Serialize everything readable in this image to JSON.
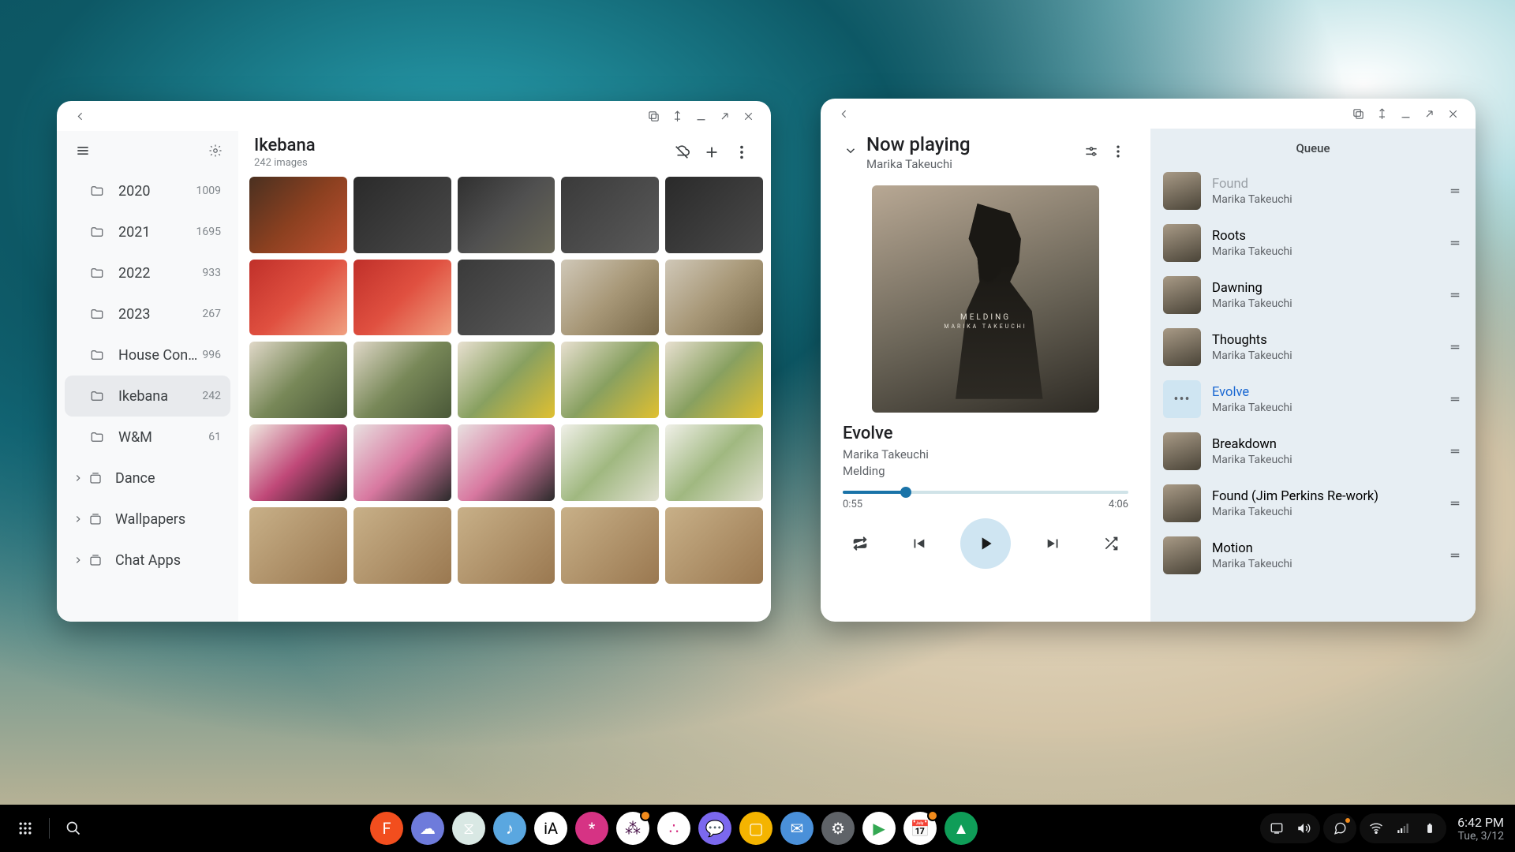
{
  "files": {
    "title": "Ikebana",
    "subtitle": "242 images",
    "folders": [
      {
        "name": "2020",
        "count": "1009"
      },
      {
        "name": "2021",
        "count": "1695"
      },
      {
        "name": "2022",
        "count": "933"
      },
      {
        "name": "2023",
        "count": "267"
      },
      {
        "name": "House Con...",
        "count": "996"
      },
      {
        "name": "Ikebana",
        "count": "242",
        "active": true
      },
      {
        "name": "W&M",
        "count": "61"
      }
    ],
    "collections": [
      {
        "name": "Dance"
      },
      {
        "name": "Wallpapers"
      },
      {
        "name": "Chat Apps"
      }
    ],
    "thumbs": [
      "th-a",
      "th-b",
      "th-c",
      "th-d",
      "th-b",
      "th-e",
      "th-e",
      "th-d",
      "th-f",
      "th-f",
      "th-g",
      "th-g",
      "th-h",
      "th-h",
      "th-h",
      "th-i",
      "th-j",
      "th-j",
      "th-k",
      "th-k",
      "th-l",
      "th-l",
      "th-l",
      "th-l",
      "th-l"
    ]
  },
  "music": {
    "now_playing_label": "Now playing",
    "np_artist": "Marika Takeuchi",
    "album_text_top": "MELDING",
    "album_text_sub": "MARIKA TAKEUCHI",
    "track": "Evolve",
    "track_artist": "Marika Takeuchi",
    "track_album": "Melding",
    "elapsed": "0:55",
    "duration": "4:06",
    "progress_pct": 22,
    "queue_label": "Queue",
    "queue": [
      {
        "title": "Found",
        "artist": "Marika Takeuchi",
        "partial": true
      },
      {
        "title": "Roots",
        "artist": "Marika Takeuchi"
      },
      {
        "title": "Dawning",
        "artist": "Marika Takeuchi"
      },
      {
        "title": "Thoughts",
        "artist": "Marika Takeuchi"
      },
      {
        "title": "Evolve",
        "artist": "Marika Takeuchi",
        "current": true
      },
      {
        "title": "Breakdown",
        "artist": "Marika Takeuchi"
      },
      {
        "title": "Found (Jim Perkins Re-work)",
        "artist": "Marika Takeuchi"
      },
      {
        "title": "Motion",
        "artist": "Marika Takeuchi"
      }
    ]
  },
  "shelf": {
    "apps": [
      {
        "name": "figma",
        "bg": "#f24e1e",
        "glyph": "F"
      },
      {
        "name": "cloud",
        "bg": "#6e7bdb",
        "glyph": "☁"
      },
      {
        "name": "hourglass",
        "bg": "#d9e8e4",
        "glyph": "⧖"
      },
      {
        "name": "music",
        "bg": "#5aa7e0",
        "glyph": "♪"
      },
      {
        "name": "ia",
        "bg": "#ffffff",
        "glyph": "iA",
        "fg": "#000"
      },
      {
        "name": "asterisk",
        "bg": "#d63384",
        "glyph": "*"
      },
      {
        "name": "slack",
        "bg": "#ffffff",
        "glyph": "⁂",
        "fg": "#4a154b",
        "badge": true
      },
      {
        "name": "circles",
        "bg": "#ffffff",
        "glyph": "∴",
        "fg": "#d63384"
      },
      {
        "name": "chat",
        "bg": "#7b68ee",
        "glyph": "💬"
      },
      {
        "name": "keep",
        "bg": "#f4b400",
        "glyph": "▢"
      },
      {
        "name": "mail",
        "bg": "#4a90d9",
        "glyph": "✉"
      },
      {
        "name": "settings",
        "bg": "#5f6368",
        "glyph": "⚙"
      },
      {
        "name": "play",
        "bg": "#ffffff",
        "glyph": "▶",
        "fg": "#34a853"
      },
      {
        "name": "calendar",
        "bg": "#ffffff",
        "glyph": "📅",
        "badge": true
      },
      {
        "name": "photos",
        "bg": "#0f9d58",
        "glyph": "▲"
      }
    ],
    "time": "6:42 PM",
    "date": "Tue, 3/12"
  }
}
